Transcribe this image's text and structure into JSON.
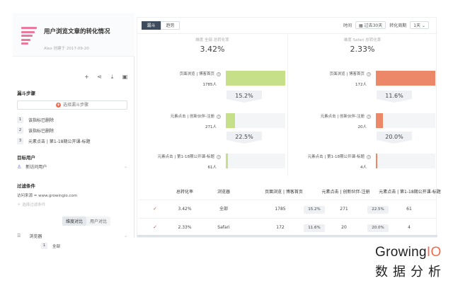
{
  "report": {
    "title": "用户浏览文章的转化情况",
    "author": "Alex 创建于 2017-09-20"
  },
  "toolbar_icons": [
    "plus-icon",
    "share-icon",
    "download-icon",
    "trash-icon"
  ],
  "sidebar": {
    "funnel_steps_title": "漏斗步骤",
    "add_step_label": "选择漏斗步骤",
    "steps": [
      {
        "num": "1",
        "label": "该指标已删除"
      },
      {
        "num": "2",
        "label": "该指标已删除"
      },
      {
        "num": "3",
        "label": "元素点击 | 第1-18期公开课-标题"
      }
    ],
    "target_users_title": "目标用户",
    "target_user_value": "新访问用户",
    "filter_title": "过滤条件",
    "filter_value": "访问来源 = www.growingio.com",
    "filter_add_label": "选择过滤条件",
    "compare_tabs": [
      {
        "label": "维度对比",
        "active": true
      },
      {
        "label": "用户对比",
        "active": false
      }
    ],
    "dimension_label": "浏览器",
    "dimension_value_num": "1",
    "dimension_value": "全部"
  },
  "main": {
    "tabs": [
      {
        "label": "漏斗",
        "active": true
      },
      {
        "label": "趋势",
        "active": false
      }
    ],
    "time_label": "时间",
    "time_value": "过去30天",
    "period_label": "转化周期",
    "period_value": "1天",
    "columns": [
      {
        "caption": "维度 全部 总转化率",
        "rate": "3.42%",
        "color": "#c6e08a",
        "rows": [
          {
            "label": "页面浏览 | 博客首页",
            "count": "1785人",
            "fraction": 1.0
          },
          {
            "label": "元素点击 | 创新伙伴-注册",
            "count": "271人",
            "fraction": 0.152
          },
          {
            "label": "元素点击 | 第1-18期公开课-标题",
            "count": "61人",
            "fraction": 0.034
          }
        ],
        "step_rates": [
          "15.2%",
          "22.5%"
        ]
      },
      {
        "caption": "维度 Safari 总转化率",
        "rate": "2.33%",
        "color": "#ec8868",
        "rows": [
          {
            "label": "页面浏览 | 博客首页",
            "count": "172人",
            "fraction": 1.0
          },
          {
            "label": "元素点击 | 创新伙伴-注册",
            "count": "20人",
            "fraction": 0.116
          },
          {
            "label": "元素点击 | 第1-18期公开课-标题",
            "count": "4人",
            "fraction": 0.023
          }
        ],
        "step_rates": [
          "11.6%",
          "20.0%"
        ]
      }
    ]
  },
  "table": {
    "headers": [
      "总转化率",
      "浏览器",
      "页面浏览 | 博客首页",
      "元素点击 | 创新伙伴-注册",
      "元素点击 | 第1-18期公开课-标题"
    ],
    "rows": [
      {
        "rate": "3.42%",
        "browser": "全部",
        "s1": "1785",
        "r1": "15.2%",
        "s2": "271",
        "r2": "22.5%",
        "s3": "61"
      },
      {
        "rate": "2.33%",
        "browser": "Safari",
        "s1": "172",
        "r1": "11.6%",
        "s2": "20",
        "r2": "20.0%",
        "s3": "4"
      }
    ]
  },
  "brand": {
    "part1": "Growing",
    "part2": "IO",
    "subtitle": "数据分析"
  }
}
